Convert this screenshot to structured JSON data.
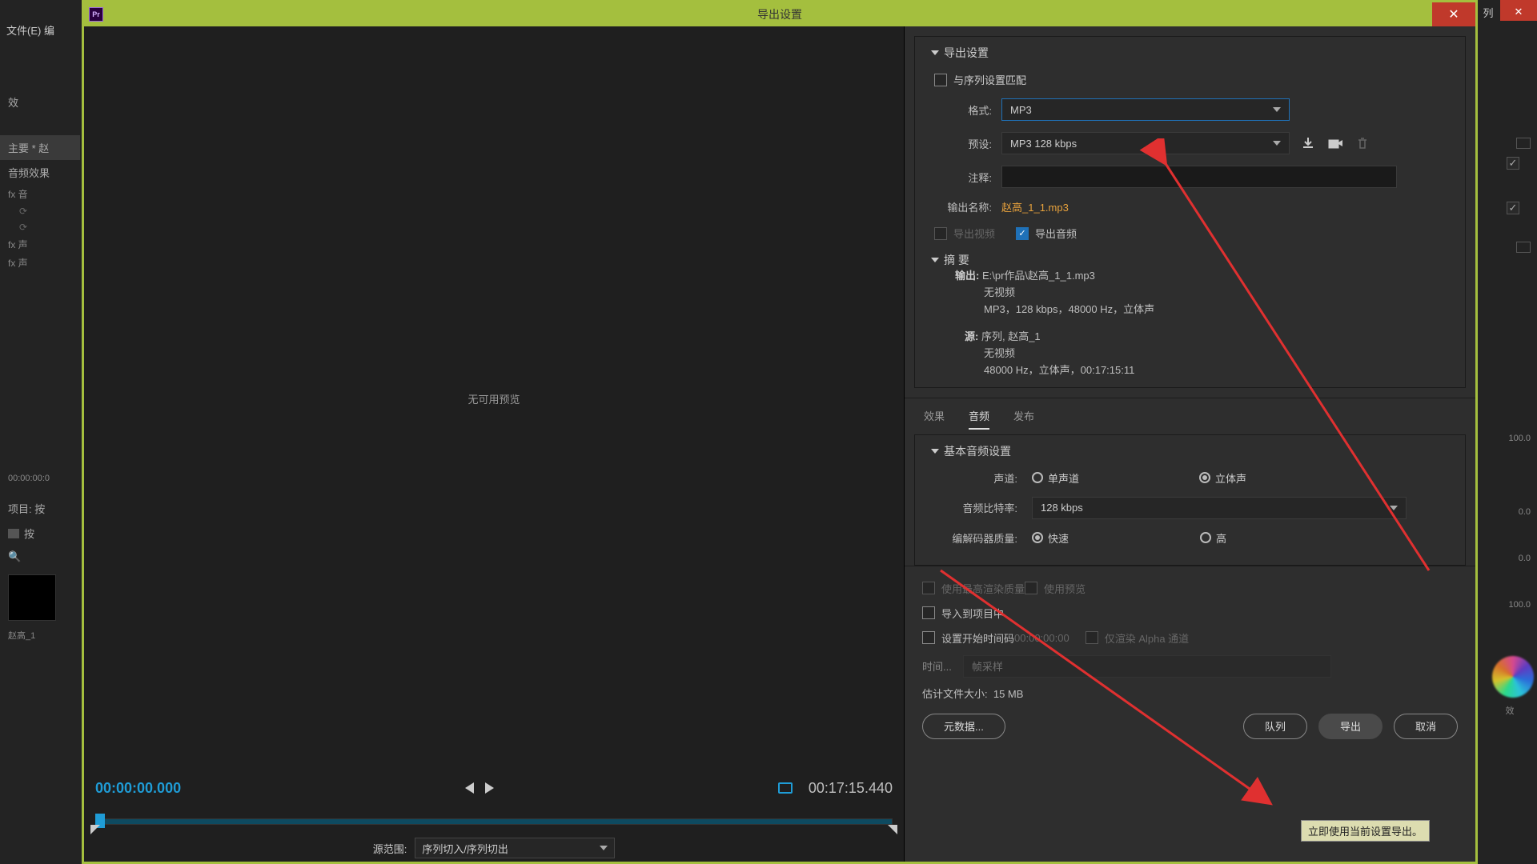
{
  "background": {
    "menu_file": "文件(E)  编",
    "tab_icon_text": "列",
    "left_panel": {
      "tab1": "效",
      "primary": "主要 * 赵",
      "audio_fx": "音频效果",
      "fx1": "fx  音",
      "fx2": "fx  声",
      "fx3": "fx  声",
      "tc": "00:00:00:0",
      "project": "项目: 按",
      "folder": "按",
      "thumb_label": "赵高_1"
    },
    "right_panel": {
      "v1": "100.0",
      "v2": "0.0",
      "v3": "0.0",
      "v4": "100.0",
      "v5": "效"
    }
  },
  "dialog": {
    "title": "导出设置",
    "preview_no": "无可用预览",
    "tc_start": "00:00:00.000",
    "tc_end": "00:17:15.440",
    "source_range_label": "源范围:",
    "source_range_value": "序列切入/序列切出",
    "export_settings": {
      "header": "导出设置",
      "match_seq": "与序列设置匹配",
      "format_label": "格式:",
      "format_value": "MP3",
      "preset_label": "预设:",
      "preset_value": "MP3 128 kbps",
      "comment_label": "注释:",
      "output_name_label": "输出名称:",
      "output_name_value": "赵高_1_1.mp3",
      "export_video": "导出视频",
      "export_audio": "导出音频"
    },
    "summary": {
      "header": "摘 要",
      "output_label": "输出:",
      "output_path": "E:\\pr作品\\赵高_1_1.mp3",
      "output_l2": "无视频",
      "output_l3": "MP3，128 kbps，48000 Hz，立体声",
      "source_label": "源:",
      "source_l1": "序列, 赵高_1",
      "source_l2": "无视频",
      "source_l3": "48000 Hz，立体声，00:17:15:11"
    },
    "tabs": {
      "t1": "效果",
      "t2": "音频",
      "t3": "发布"
    },
    "audio_settings": {
      "header": "基本音频设置",
      "channel_label": "声道:",
      "mono": "单声道",
      "stereo": "立体声",
      "bitrate_label": "音频比特率:",
      "bitrate_value": "128 kbps",
      "quality_label": "编解码器质量:",
      "fast": "快速",
      "high": "高"
    },
    "bottom": {
      "max_render": "使用最高渲染质量",
      "use_preview": "使用预览",
      "import_proj": "导入到项目中",
      "set_start_tc": "设置开始时间码",
      "start_tc_value": "00:00:00:00",
      "alpha_only": "仅渲染 Alpha 通道",
      "time_label": "时间...",
      "time_placeholder": "帧采样",
      "est_label": "估计文件大小:",
      "est_value": "15 MB",
      "metadata": "元数据...",
      "queue": "队列",
      "export": "导出",
      "cancel": "取消",
      "tooltip": "立即使用当前设置导出。"
    }
  }
}
